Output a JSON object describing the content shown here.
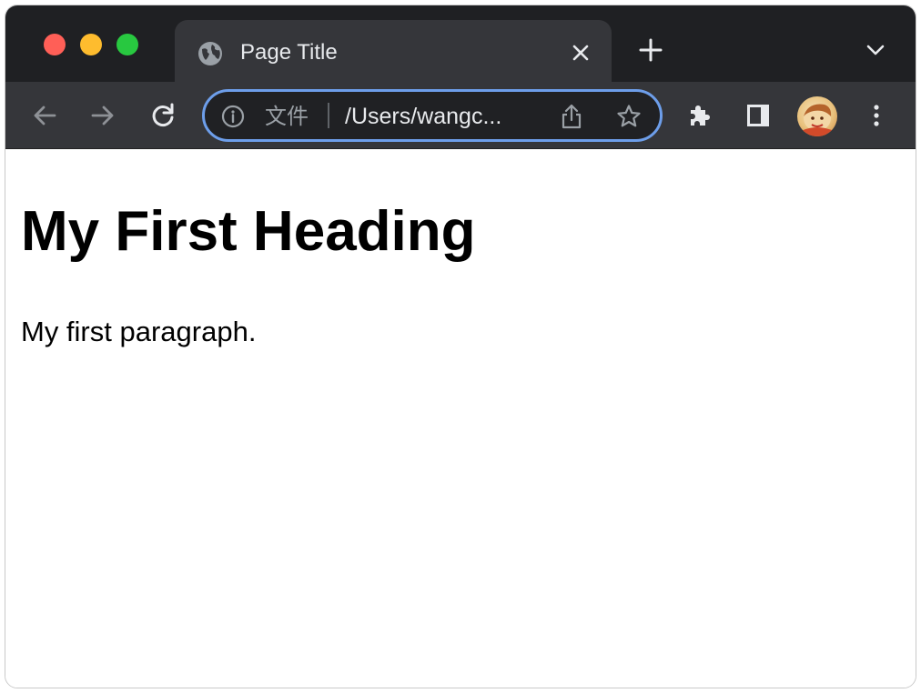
{
  "window": {
    "tab": {
      "title": "Page Title"
    },
    "omnibox": {
      "scheme_label": "文件",
      "url": "/Users/wangc..."
    }
  },
  "page": {
    "heading": "My First Heading",
    "paragraph": "My first paragraph."
  },
  "colors": {
    "tabstrip_bg": "#1f2023",
    "toolbar_bg": "#35363a",
    "omnibox_focus": "#6d9eea",
    "close_red": "#ff5f57",
    "minimize_yellow": "#febc2e",
    "zoom_green": "#28c840"
  },
  "icons": {
    "traffic": [
      "close-window-icon",
      "minimize-window-icon",
      "zoom-window-icon"
    ],
    "tab": [
      "globe-favicon-icon",
      "close-tab-icon",
      "new-tab-icon",
      "tab-search-chevron-icon"
    ],
    "toolbar": [
      "back-arrow-icon",
      "forward-arrow-icon",
      "reload-icon",
      "site-info-icon",
      "share-icon",
      "bookmark-star-icon",
      "extensions-puzzle-icon",
      "side-panel-icon",
      "profile-avatar",
      "more-menu-icon"
    ]
  }
}
